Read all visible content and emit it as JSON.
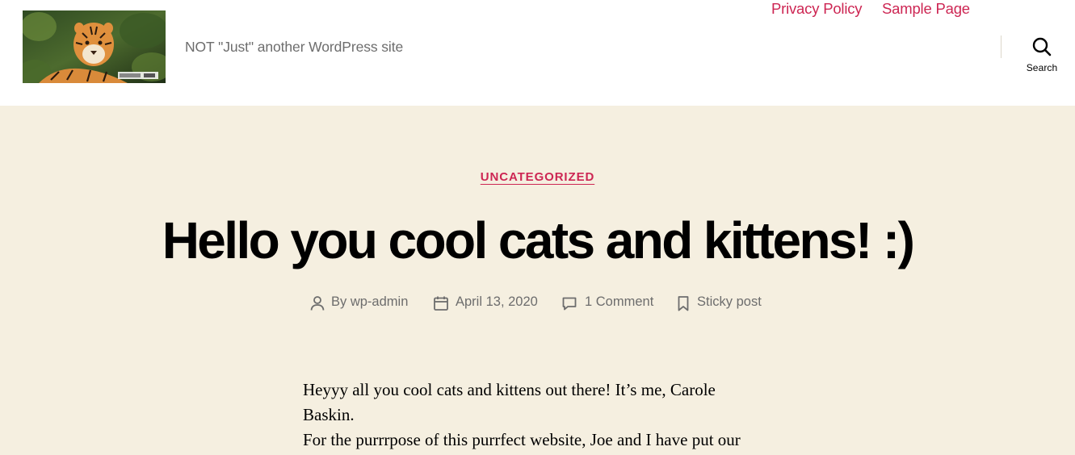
{
  "header": {
    "tagline": "NOT \"Just\" another WordPress site",
    "logo_image": "tiger-photo-logo",
    "nav": [
      {
        "label": "Privacy Policy"
      },
      {
        "label": "Sample Page"
      }
    ],
    "search_label": "Search",
    "accent_color": "#cd2653",
    "background_color": "#ffffff"
  },
  "post": {
    "category": "UNCATEGORIZED",
    "title": "Hello you cool cats and kittens! :)",
    "meta": {
      "author": "By wp-admin",
      "date": "April 13, 2020",
      "comments": "1 Comment",
      "sticky": "Sticky post"
    },
    "content": [
      "Heyyy all you cool cats and kittens out there! It’s me, Carole Baskin.",
      "For the purrrpose of this purrfect website, Joe and I have put our"
    ],
    "background_color": "#f5efe0"
  }
}
